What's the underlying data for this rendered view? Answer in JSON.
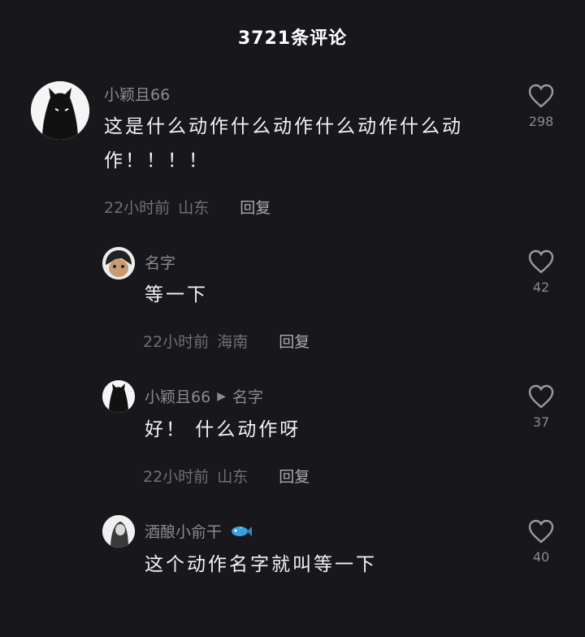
{
  "header": {
    "title": "3721条评论"
  },
  "comments": [
    {
      "username": "小颖且66",
      "text": "这是什么动作什么动作什么动作什么动作！！！！",
      "time": "22小时前",
      "location": "山东",
      "reply_label": "回复",
      "likes": "298"
    },
    {
      "username": "名字",
      "text": "等一下",
      "time": "22小时前",
      "location": "海南",
      "reply_label": "回复",
      "likes": "42"
    },
    {
      "username": "小颖且66",
      "reply_to": "名字",
      "text": "好！ 什么动作呀",
      "time": "22小时前",
      "location": "山东",
      "reply_label": "回复",
      "likes": "37"
    },
    {
      "username": "酒酿小俞干",
      "badge_icon": "fish-icon",
      "text": "这个动作名字就叫等一下",
      "likes": "40"
    }
  ],
  "colors": {
    "background": "#17171c",
    "muted": "#8a8a90",
    "text": "#f4f4f4"
  }
}
